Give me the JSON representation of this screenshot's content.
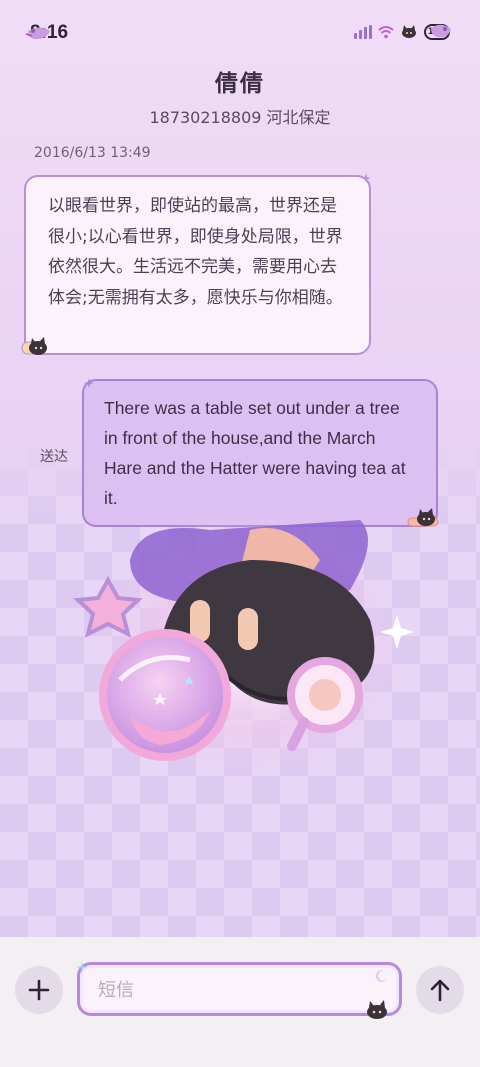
{
  "status_bar": {
    "time": "8:16",
    "battery_level": "100",
    "icons": [
      "signal-bars-icon",
      "wifi-icon",
      "cat-sticker-icon",
      "battery-icon"
    ]
  },
  "header": {
    "contact_name": "倩倩",
    "contact_detail": "18730218809 河北保定"
  },
  "messages": [
    {
      "timestamp": "2016/6/13 13:49",
      "direction": "incoming",
      "text": "以眼看世界，即使站的最高，世界还是很小;以心看世界，即使身处局限，世界依然很大。生活远不完美，需要用心去体会;无需拥有太多，愿快乐与你相随。"
    },
    {
      "direction": "outgoing",
      "status": "送达",
      "text": "There was a table set out under a tree in front of the house,and the March Hare and the Hatter were having tea at it."
    }
  ],
  "compose": {
    "placeholder": "短信",
    "add_icon": "plus-icon",
    "send_icon": "arrow-up-icon"
  },
  "theme": {
    "accent": "#b98fd6",
    "bubble_in": "#fbf2fb",
    "bubble_out": "#dcc0f2"
  }
}
